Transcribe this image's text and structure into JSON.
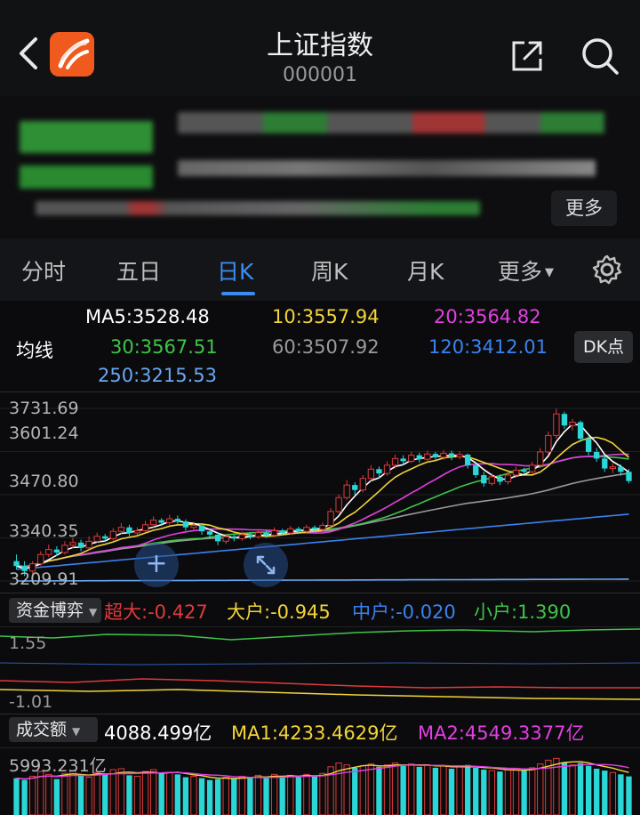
{
  "header": {
    "title": "上证指数",
    "code": "000001"
  },
  "quote": {
    "more_label": "更多"
  },
  "tabs": [
    "分时",
    "五日",
    "日K",
    "周K",
    "月K",
    "更多"
  ],
  "ma": {
    "label": "均线",
    "ma5": "MA5:3528.48",
    "ma10": "10:3557.94",
    "ma20": "20:3564.82",
    "ma30": "30:3567.51",
    "ma60": "60:3507.92",
    "ma120": "120:3412.01",
    "ma250": "250:3215.53",
    "dk_button": "DK点"
  },
  "price_axis": [
    "3731.69",
    "3601.24",
    "3470.80",
    "3340.35",
    "3209.91"
  ],
  "fund_flow": {
    "selector": "资金博弈",
    "super_large": "超大:-0.427",
    "large": "大户:-0.945",
    "medium": "中户:-0.020",
    "small": "小户:1.390",
    "axis_top": "1.55",
    "axis_bottom": "-1.01"
  },
  "volume": {
    "selector": "成交额",
    "value": "4088.499亿",
    "ma1": "MA1:4233.4629亿",
    "ma2": "MA2:4549.3377亿",
    "axis_top": "5993.231亿"
  },
  "colors": {
    "up": "#e03a3a",
    "down": "#2ad6d6",
    "ma5": "#ffffff",
    "ma10": "#f2d43b",
    "ma20": "#e040e0",
    "ma30": "#3fc44a",
    "ma60": "#9a9a9a",
    "ma120": "#3b82f0",
    "ma250": "#6aa8f0",
    "accent": "#3b8cf0"
  },
  "chart_data": {
    "type": "candlestick",
    "y_axis_ticks": [
      3731.69,
      3601.24,
      3470.8,
      3340.35,
      3209.91
    ],
    "ylim": [
      3209.91,
      3731.69
    ],
    "candles": [
      [
        3270,
        3255,
        3290,
        3245
      ],
      [
        3255,
        3240,
        3270,
        3225
      ],
      [
        3240,
        3262,
        3270,
        3232
      ],
      [
        3262,
        3290,
        3300,
        3255
      ],
      [
        3290,
        3305,
        3320,
        3282
      ],
      [
        3305,
        3296,
        3315,
        3285
      ],
      [
        3296,
        3318,
        3330,
        3290
      ],
      [
        3318,
        3326,
        3340,
        3310
      ],
      [
        3326,
        3310,
        3335,
        3300
      ],
      [
        3310,
        3330,
        3345,
        3305
      ],
      [
        3330,
        3345,
        3356,
        3325
      ],
      [
        3345,
        3338,
        3352,
        3328
      ],
      [
        3338,
        3360,
        3370,
        3332
      ],
      [
        3360,
        3372,
        3385,
        3352
      ],
      [
        3372,
        3355,
        3380,
        3345
      ],
      [
        3355,
        3362,
        3372,
        3348
      ],
      [
        3362,
        3380,
        3392,
        3356
      ],
      [
        3380,
        3394,
        3405,
        3372
      ],
      [
        3394,
        3386,
        3400,
        3376
      ],
      [
        3386,
        3398,
        3410,
        3380
      ],
      [
        3398,
        3390,
        3408,
        3382
      ],
      [
        3390,
        3372,
        3396,
        3362
      ],
      [
        3372,
        3378,
        3388,
        3364
      ],
      [
        3378,
        3360,
        3384,
        3350
      ],
      [
        3360,
        3350,
        3368,
        3340
      ],
      [
        3350,
        3330,
        3356,
        3318
      ],
      [
        3330,
        3344,
        3352,
        3322
      ],
      [
        3344,
        3338,
        3350,
        3330
      ],
      [
        3338,
        3350,
        3360,
        3332
      ],
      [
        3350,
        3344,
        3358,
        3336
      ],
      [
        3344,
        3356,
        3364,
        3338
      ],
      [
        3356,
        3348,
        3362,
        3340
      ],
      [
        3348,
        3362,
        3372,
        3342
      ],
      [
        3362,
        3355,
        3368,
        3348
      ],
      [
        3355,
        3368,
        3376,
        3350
      ],
      [
        3368,
        3360,
        3374,
        3352
      ],
      [
        3360,
        3372,
        3380,
        3354
      ],
      [
        3372,
        3366,
        3378,
        3358
      ],
      [
        3366,
        3378,
        3386,
        3360
      ],
      [
        3378,
        3420,
        3430,
        3372
      ],
      [
        3420,
        3462,
        3472,
        3415
      ],
      [
        3462,
        3500,
        3515,
        3455
      ],
      [
        3500,
        3485,
        3508,
        3470
      ],
      [
        3485,
        3520,
        3530,
        3478
      ],
      [
        3520,
        3548,
        3560,
        3512
      ],
      [
        3548,
        3535,
        3556,
        3520
      ],
      [
        3535,
        3560,
        3572,
        3528
      ],
      [
        3560,
        3580,
        3592,
        3550
      ],
      [
        3580,
        3572,
        3590,
        3560
      ],
      [
        3572,
        3590,
        3600,
        3566
      ],
      [
        3590,
        3578,
        3598,
        3568
      ],
      [
        3578,
        3594,
        3604,
        3570
      ],
      [
        3594,
        3584,
        3600,
        3574
      ],
      [
        3584,
        3596,
        3606,
        3576
      ],
      [
        3596,
        3585,
        3604,
        3575
      ],
      [
        3585,
        3592,
        3602,
        3578
      ],
      [
        3592,
        3560,
        3595,
        3550
      ],
      [
        3560,
        3530,
        3566,
        3522
      ],
      [
        3530,
        3505,
        3540,
        3495
      ],
      [
        3505,
        3525,
        3535,
        3498
      ],
      [
        3525,
        3510,
        3532,
        3500
      ],
      [
        3510,
        3530,
        3540,
        3502
      ],
      [
        3530,
        3545,
        3556,
        3522
      ],
      [
        3545,
        3540,
        3552,
        3532
      ],
      [
        3540,
        3560,
        3570,
        3534
      ],
      [
        3560,
        3600,
        3612,
        3552
      ],
      [
        3600,
        3650,
        3662,
        3592
      ],
      [
        3650,
        3715,
        3731,
        3640
      ],
      [
        3715,
        3680,
        3722,
        3670
      ],
      [
        3680,
        3690,
        3700,
        3665
      ],
      [
        3690,
        3640,
        3695,
        3630
      ],
      [
        3640,
        3600,
        3648,
        3590
      ],
      [
        3600,
        3580,
        3612,
        3570
      ],
      [
        3580,
        3550,
        3590,
        3540
      ],
      [
        3550,
        3555,
        3566,
        3536
      ],
      [
        3555,
        3540,
        3562,
        3528
      ],
      [
        3540,
        3512,
        3548,
        3505
      ]
    ],
    "ma_series": [
      {
        "name": "MA5",
        "last": 3528.48
      },
      {
        "name": "10",
        "last": 3557.94
      },
      {
        "name": "20",
        "last": 3564.82
      },
      {
        "name": "30",
        "last": 3567.51
      },
      {
        "name": "60",
        "last": 3507.92
      },
      {
        "name": "120",
        "last": 3412.01
      },
      {
        "name": "250",
        "last": 3215.53
      }
    ],
    "volume_values": [
      3900,
      3700,
      4100,
      4600,
      4300,
      3800,
      4400,
      4700,
      4200,
      4000,
      4500,
      4300,
      4800,
      4900,
      4200,
      4100,
      4600,
      4800,
      4400,
      4500,
      4300,
      4000,
      4100,
      3900,
      3700,
      3800,
      4000,
      3900,
      4100,
      4000,
      4200,
      3900,
      4300,
      4100,
      4200,
      4000,
      4300,
      4100,
      4400,
      5100,
      5500,
      5300,
      5000,
      5200,
      5400,
      5100,
      5300,
      5500,
      5200,
      5400,
      5100,
      5300,
      5000,
      5200,
      4900,
      5100,
      5300,
      5000,
      4800,
      4700,
      4600,
      4800,
      4900,
      4700,
      5000,
      5400,
      5800,
      5993,
      5600,
      5300,
      5500,
      5200,
      4900,
      4700,
      4500,
      4300,
      4088
    ]
  }
}
